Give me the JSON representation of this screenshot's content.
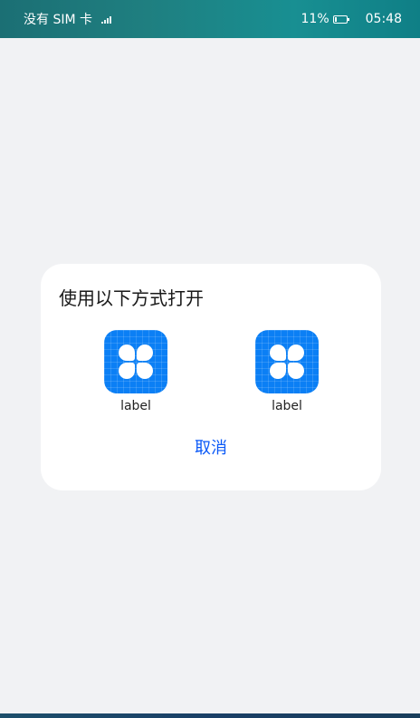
{
  "status_bar": {
    "carrier": "没有 SIM 卡",
    "battery": "11%",
    "time": "05:48"
  },
  "dialog": {
    "title": "使用以下方式打开",
    "apps": [
      {
        "label": "label"
      },
      {
        "label": "label"
      }
    ],
    "cancel_label": "取消"
  },
  "colors": {
    "accent": "#0a59f7",
    "app_icon": "#0b7ff5",
    "background": "#f1f2f4",
    "dialog_bg": "#ffffff"
  },
  "icons": {
    "signal": "signal-icon",
    "battery": "battery-icon",
    "app": "app-grid-icon"
  }
}
